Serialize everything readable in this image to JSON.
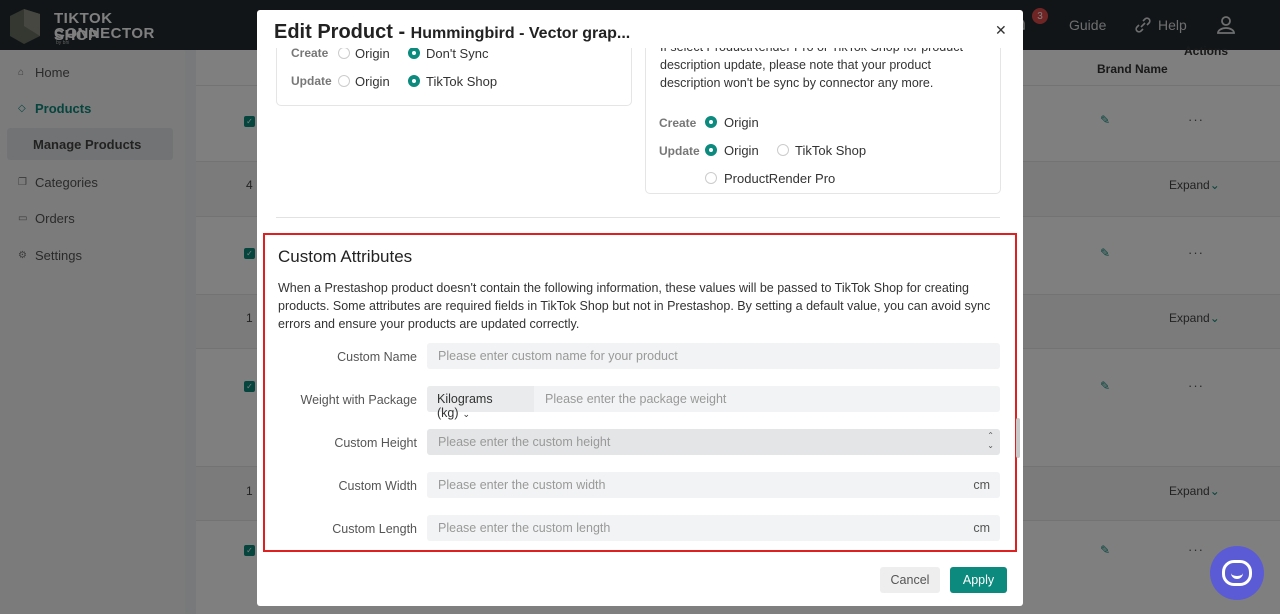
{
  "app": {
    "logo_line1": "TIKTOK SHOP",
    "logo_line2": "CONNECTOR",
    "logo_by": "by bhi",
    "notifications": "3",
    "guide": "Guide",
    "help": "Help"
  },
  "sidebar": {
    "items": [
      {
        "label": "Home"
      },
      {
        "label": "Products"
      },
      {
        "label": "Manage Products"
      },
      {
        "label": "Categories"
      },
      {
        "label": "Orders"
      },
      {
        "label": "Settings"
      }
    ]
  },
  "table": {
    "brand_header": "Brand Name",
    "actions_header": "Actions",
    "expand": "Expand",
    "row_nums": [
      "4",
      "1",
      "1"
    ]
  },
  "modal": {
    "title_prefix": "Edit Product -",
    "title_product": "Hummingbird - Vector grap...",
    "left_card": {
      "create_label": "Create",
      "create_options": [
        "Origin",
        "Don't Sync"
      ],
      "update_label": "Update",
      "update_options": [
        "Origin",
        "TikTok Shop"
      ]
    },
    "right_card": {
      "note": "If select ProductRender Pro or TikTok Shop for product description update, please note that your product description won't be sync by connector any more.",
      "create_label": "Create",
      "create_options": [
        "Origin"
      ],
      "update_label": "Update",
      "update_options": [
        "Origin",
        "TikTok Shop",
        "ProductRender Pro"
      ]
    },
    "custom_attributes": {
      "title": "Custom Attributes",
      "description": "When a Prestashop product doesn't contain the following information, these values will be passed to TikTok Shop for creating products. Some attributes are required fields in TikTok Shop but not in Prestashop. By setting a default value, you can avoid sync errors and ensure your products are updated correctly.",
      "custom_name_label": "Custom Name",
      "custom_name_placeholder": "Please enter custom name for your product",
      "weight_label": "Weight with Package",
      "weight_unit": "Kilograms (kg)",
      "weight_placeholder": "Please enter the package weight",
      "height_label": "Custom Height",
      "height_placeholder": "Please enter the custom height",
      "width_label": "Custom Width",
      "width_placeholder": "Please enter the custom width",
      "width_unit": "cm",
      "length_label": "Custom Length",
      "length_placeholder": "Please enter the custom length",
      "length_unit": "cm"
    },
    "cancel": "Cancel",
    "apply": "Apply"
  }
}
